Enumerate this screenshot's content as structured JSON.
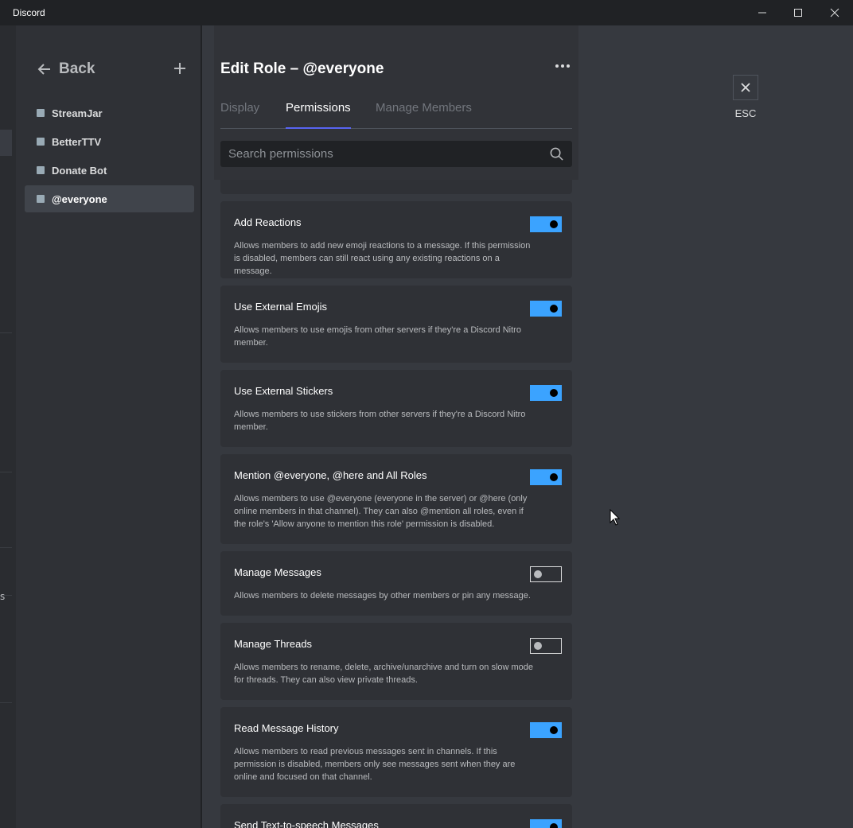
{
  "window": {
    "title": "Discord",
    "minimize_icon": "minimize-icon",
    "maximize_icon": "maximize-icon",
    "close_icon": "close-icon"
  },
  "edge": {
    "letter": "s"
  },
  "sidebar": {
    "back_label": "Back",
    "roles": [
      {
        "name": "StreamJar",
        "active": false
      },
      {
        "name": "BetterTTV",
        "active": false
      },
      {
        "name": "Donate Bot",
        "active": false
      },
      {
        "name": "@everyone",
        "active": true
      }
    ]
  },
  "header": {
    "title": "Edit Role – @everyone",
    "tabs": [
      {
        "label": "Display",
        "active": false
      },
      {
        "label": "Permissions",
        "active": true
      },
      {
        "label": "Manage Members",
        "active": false
      }
    ],
    "search": {
      "placeholder": "Search permissions",
      "value": ""
    }
  },
  "permissions": [
    {
      "name": "Add Reactions",
      "desc": "Allows members to add new emoji reactions to a message. If this permission is disabled, members can still react using any existing reactions on a message.",
      "enabled": true
    },
    {
      "name": "Use External Emojis",
      "desc": "Allows members to use emojis from other servers if they're a Discord Nitro member.",
      "enabled": true
    },
    {
      "name": "Use External Stickers",
      "desc": "Allows members to use stickers from other servers if they're a Discord Nitro member.",
      "enabled": true
    },
    {
      "name": "Mention @everyone, @here and All Roles",
      "desc": "Allows members to use @everyone (everyone in the server) or @here (only online members in that channel). They can also @mention all roles, even if the role's 'Allow anyone to mention this role' permission is disabled.",
      "enabled": true
    },
    {
      "name": "Manage Messages",
      "desc": "Allows members to delete messages by other members or pin any message.",
      "enabled": false
    },
    {
      "name": "Manage Threads",
      "desc": "Allows members to rename, delete, archive/unarchive and turn on slow mode for threads. They can also view private threads.",
      "enabled": false
    },
    {
      "name": "Read Message History",
      "desc": "Allows members to read previous messages sent in channels. If this permission is disabled, members only see messages sent when they are online and focused on that channel.",
      "enabled": true
    },
    {
      "name": "Send Text-to-speech Messages",
      "desc": "",
      "enabled": true
    }
  ],
  "close": {
    "label": "ESC"
  },
  "colors": {
    "toggle_on": "#3ba3ff",
    "tab_indicator": "#5865f2",
    "background": "#36393f",
    "sidebar": "#2f3136"
  }
}
